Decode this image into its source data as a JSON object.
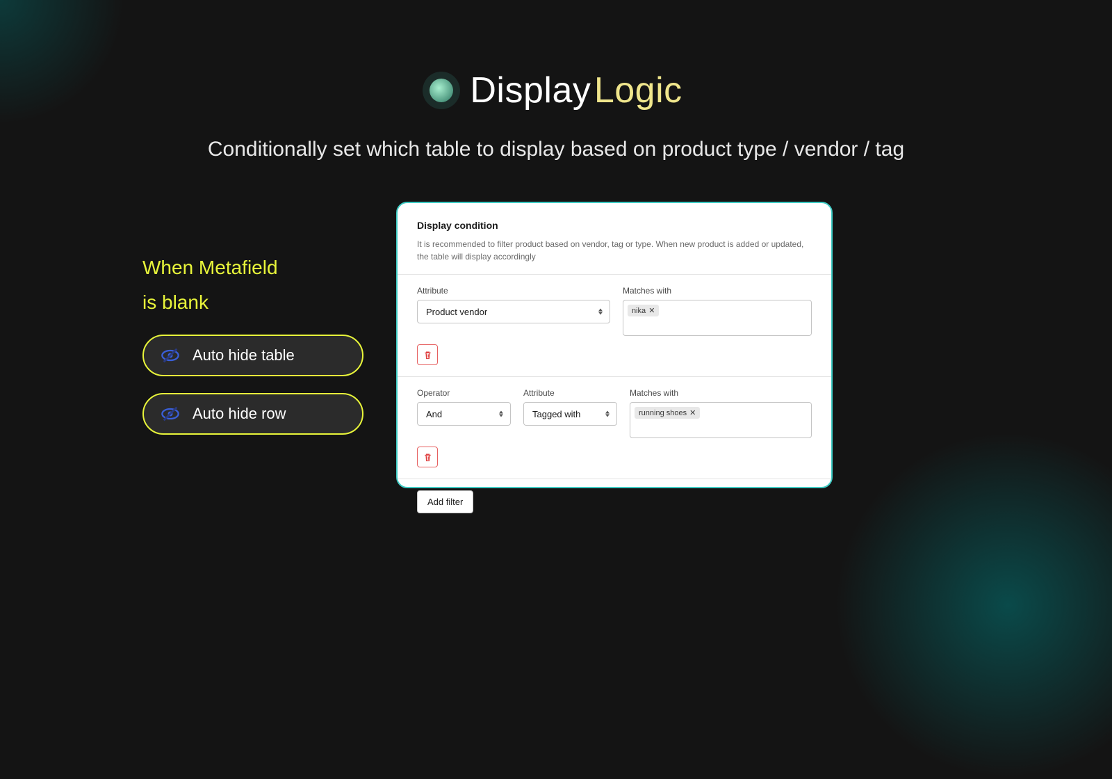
{
  "header": {
    "title_main": "Display",
    "title_accent": "Logic",
    "subtitle": "Conditionally set which table to display based on product type / vendor / tag"
  },
  "left": {
    "heading_line1": "When Metafield",
    "heading_line2": "is blank",
    "buttons": [
      "Auto hide table",
      "Auto hide row"
    ]
  },
  "panel": {
    "title": "Display condition",
    "description": "It is recommended to filter product based on vendor, tag or type. When new product is added or updated, the table will display accordingly",
    "labels": {
      "attribute": "Attribute",
      "matches_with": "Matches with",
      "operator": "Operator"
    },
    "rows": [
      {
        "attribute": "Product vendor",
        "tags": [
          "nika"
        ]
      },
      {
        "operator": "And",
        "attribute": "Tagged with",
        "tags": [
          "running shoes"
        ]
      }
    ],
    "add_filter": "Add filter"
  }
}
